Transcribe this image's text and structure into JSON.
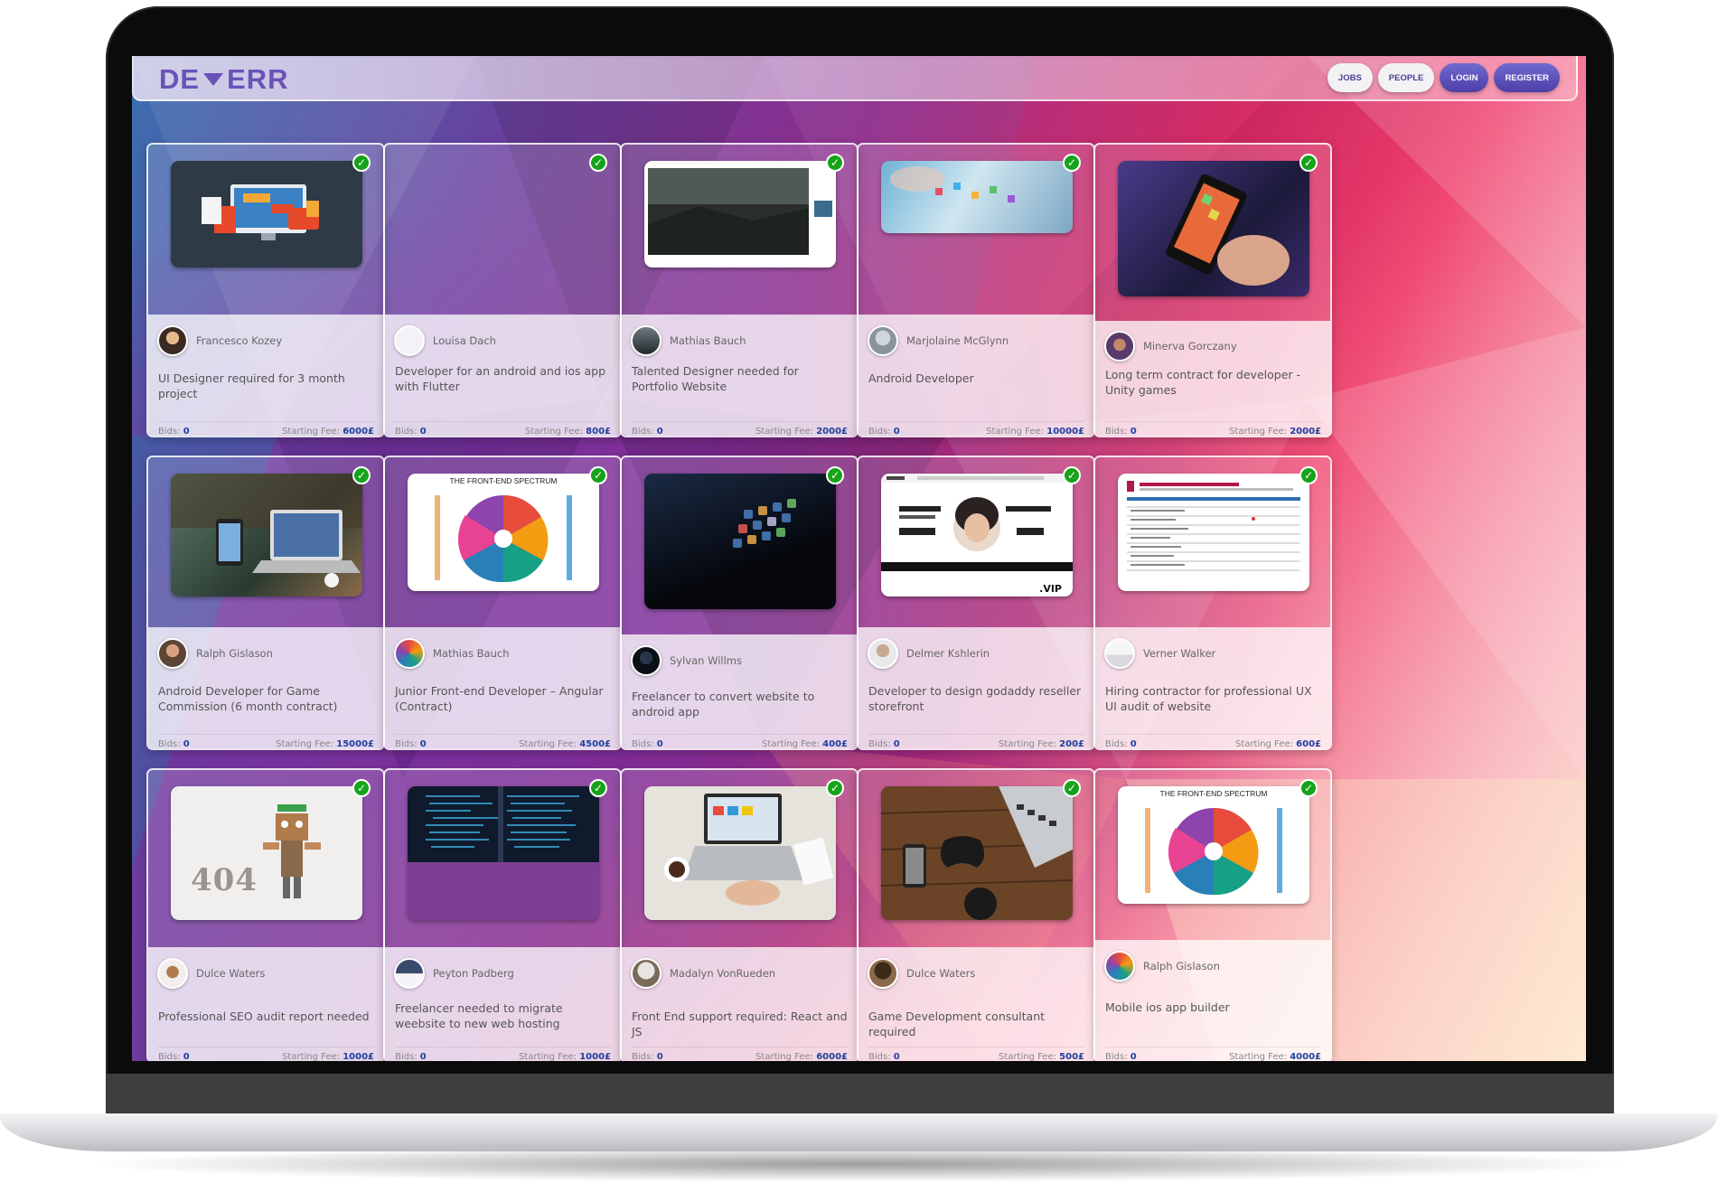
{
  "logo": {
    "part1": "DE",
    "part2": "ERR"
  },
  "nav": {
    "jobs": "JOBS",
    "people": "PEOPLE",
    "login": "LOGIN",
    "register": "REGISTER"
  },
  "labels": {
    "bids": "Bids:",
    "fee": "Starting Fee:"
  },
  "cards": [
    {
      "author": "Francesco Kozey",
      "title": "UI Designer required for 3 month project",
      "bids": "0",
      "fee": "6000£"
    },
    {
      "author": "Louisa Dach",
      "title": "Developer for an android and ios app with Flutter",
      "bids": "0",
      "fee": "800£"
    },
    {
      "author": "Mathias Bauch",
      "title": "Talented Designer needed for Portfolio Website",
      "bids": "0",
      "fee": "2000£"
    },
    {
      "author": "Marjolaine McGlynn",
      "title": "Android Developer",
      "bids": "0",
      "fee": "10000£"
    },
    {
      "author": "Minerva Gorczany",
      "title": "Long term contract for developer - Unity games",
      "bids": "0",
      "fee": "2000£"
    },
    {
      "author": "Ralph Gislason",
      "title": "Android Developer for Game Commission (6 month contract)",
      "bids": "0",
      "fee": "15000£"
    },
    {
      "author": "Mathias Bauch",
      "title": "Junior Front-end Developer – Angular (Contract)",
      "bids": "0",
      "fee": "4500£",
      "img_text": "THE FRONT-END SPECTRUM"
    },
    {
      "author": "Sylvan Willms",
      "title": "Freelancer to convert website to android app",
      "bids": "0",
      "fee": "400£"
    },
    {
      "author": "Delmer Kshlerin",
      "title": "Developer to design godaddy reseller storefront",
      "bids": "0",
      "fee": "200£",
      "img_text": ".VIP"
    },
    {
      "author": "Verner Walker",
      "title": "Hiring contractor for professional UX UI audit of website",
      "bids": "0",
      "fee": "600£"
    },
    {
      "author": "Dulce Waters",
      "title": "Professional SEO audit report needed",
      "bids": "0",
      "fee": "1000£",
      "img_text": "404"
    },
    {
      "author": "Peyton Padberg",
      "title": "Freelancer needed to migrate weebsite to new web hosting",
      "bids": "0",
      "fee": "1000£"
    },
    {
      "author": "Madalyn VonRueden",
      "title": "Front End support required: React and JS",
      "bids": "0",
      "fee": "6000£"
    },
    {
      "author": "Dulce Waters",
      "title": "Game Development consultant required",
      "bids": "0",
      "fee": "500£"
    },
    {
      "author": "Ralph Gislason",
      "title": "Mobile ios app builder",
      "bids": "0",
      "fee": "4000£",
      "img_text": "THE FRONT-END SPECTRUM"
    }
  ]
}
